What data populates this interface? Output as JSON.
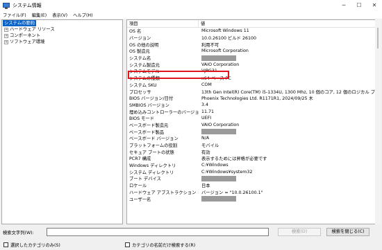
{
  "window": {
    "title": "システム情報",
    "icon": "system-info-icon",
    "controls": {
      "minimize": "─",
      "maximize": "☐",
      "close": "✕"
    }
  },
  "menu": {
    "file": "ファイル(F)",
    "edit": "編集(E)",
    "view": "表示(V)",
    "help": "ヘルプ(H)"
  },
  "tree": {
    "root": "システムの要約",
    "items": [
      {
        "label": "ハードウェア リソース",
        "expander": "+"
      },
      {
        "label": "コンポーネント",
        "expander": "+"
      },
      {
        "label": "ソフトウェア環境",
        "expander": "+"
      }
    ]
  },
  "list": {
    "headers": {
      "item": "項目",
      "value": "値"
    },
    "rows": [
      {
        "item": "OS 名",
        "value": "Microsoft Windows 11"
      },
      {
        "item": "バージョン",
        "value": "10.0.26100 ビルド 26100"
      },
      {
        "item": "OS の他の説明",
        "value": "利用不可"
      },
      {
        "item": "OS 製造元",
        "value": "Microsoft Corporation"
      },
      {
        "item": "システム名",
        "value": "",
        "redacted": true
      },
      {
        "item": "システム製造元",
        "value": "VAIO Corporation"
      },
      {
        "item": "システムモデル",
        "value": "VJPG31"
      },
      {
        "item": "システムの種類",
        "value": "x64-ベース PC"
      },
      {
        "item": "システム SKU",
        "value": "COM"
      },
      {
        "item": "プロセッサ",
        "value": "13th Gen Intel(R) Core(TM) i5-1334U, 1300 Mhz, 10 個のコア, 12 個のロジカル プ..."
      },
      {
        "item": "BIOS バージョン/日付",
        "value": "Phoenix Technologies Ltd. R1171R1, 2024/09/25 木"
      },
      {
        "item": "SMBIOS バージョン",
        "value": "3.4"
      },
      {
        "item": "埋め込みコントローラーのバージョン",
        "value": "11.71"
      },
      {
        "item": "BIOS モード",
        "value": "UEFI"
      },
      {
        "item": "ベースボード製造元",
        "value": "VAIO Corporation"
      },
      {
        "item": "ベースボード製品",
        "value": "",
        "redacted": true
      },
      {
        "item": "ベースボード バージョン",
        "value": "N/A"
      },
      {
        "item": "プラットフォームの役割",
        "value": "モバイル"
      },
      {
        "item": "セキュア ブートの状態",
        "value": "有効"
      },
      {
        "item": "PCR7 構成",
        "value": "表示するためには昇格が必要です"
      },
      {
        "item": "Windows ディレクトリ",
        "value": "C:¥Windows"
      },
      {
        "item": "システム ディレクトリ",
        "value": "C:¥Windows¥system32"
      },
      {
        "item": "ブート デバイス",
        "value": "",
        "redacted": true
      },
      {
        "item": "ロケール",
        "value": "日本"
      },
      {
        "item": "ハードウェア アブストラクション レイヤー",
        "value": "バージョン = \"10.0.26100.1\""
      },
      {
        "item": "ユーザー名",
        "value": "",
        "redacted": true
      }
    ],
    "highlighted_row": "システムモデル",
    "highlight_color": "#e0151c"
  },
  "search": {
    "label": "検索文字列(W):",
    "value": "",
    "find_button": "検索(D)",
    "close_button": "検索を閉じる(C)",
    "option_selected_only": "選択したカテゴリのみ(S)",
    "option_names_only": "カテゴリの名前だけ検索する(R)"
  },
  "colors": {
    "selection": "#0a64c8",
    "background": "#f0f0f0"
  }
}
